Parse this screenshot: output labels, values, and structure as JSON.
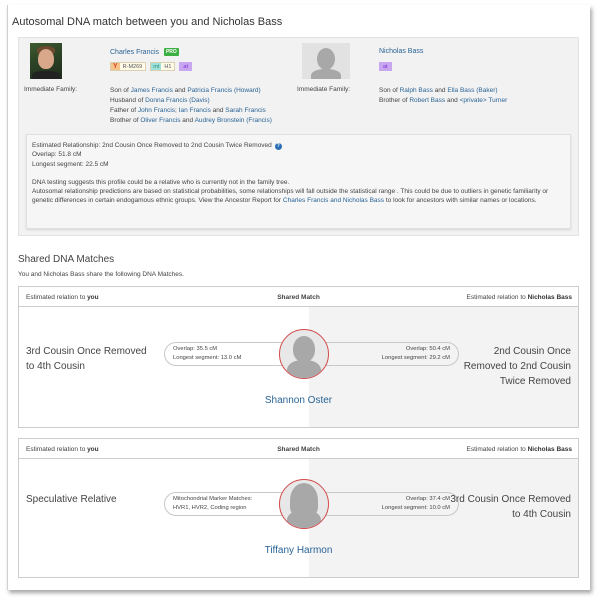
{
  "title": "Autosomal DNA match between you and Nicholas Bass",
  "you": {
    "name": "Charles Francis",
    "pro_badge": "PRO",
    "badges": [
      {
        "key": "Y",
        "value": "R-M269"
      },
      {
        "key": "mt",
        "value": "H1"
      },
      {
        "key": "at",
        "value": ""
      }
    ],
    "family_label": "Immediate Family:",
    "family": {
      "son_of_prefix": "Son of ",
      "father1": "James Francis",
      "and1": " and ",
      "mother1": "Patricia Francis (Howard)",
      "husband_prefix": "Husband of ",
      "spouse": "Donna Francis (Davis)",
      "father_of_prefix": "Father of ",
      "child1": "John Francis",
      "sep": "; ",
      "child2": "Ian Francis",
      "and2": " and ",
      "child3": "Sarah Francis",
      "brother_prefix": "Brother of ",
      "sib1": "Oliver Francis",
      "and3": " and ",
      "sib2": "Audrey Bronstein (Francis)"
    }
  },
  "them": {
    "name": "Nicholas Bass",
    "badges": [
      {
        "key": "at",
        "value": ""
      }
    ],
    "family_label": "Immediate Family:",
    "family": {
      "son_of_prefix": "Son of ",
      "father1": "Ralph Bass",
      "and1": " and ",
      "mother1": "Ella Bass (Baker)",
      "brother_prefix": "Brother of ",
      "sib1": "Robert Bass",
      "and2": " and ",
      "sib2": "<private> Turner"
    }
  },
  "estimate": {
    "relationship": "Estimated Relationship: 2nd Cousin Once Removed to 2nd Cousin Twice Removed",
    "overlap": "Overlap: 51.8 cM",
    "longest": "Longest segment: 22.5 cM",
    "note1": "DNA testing suggests this profile could be a relative who is currently not in the family tree.",
    "note2_a": "Autosomal relationship predictions are based on statistical probabilities, some relationships will fall outside the statistical range . This could be due to outliers in genetic familiarity or genetic differences in certain endogamous ethnic groups. View the Ancestor Report for ",
    "note2_link": "Charles Francis and Nicholas Bass",
    "note2_b": " to look for ancestors with similar names or locations."
  },
  "shared": {
    "title": "Shared DNA Matches",
    "subtitle": "You and Nicholas Bass share the following DNA Matches.",
    "header": {
      "col1_prefix": "Estimated relation to ",
      "col1_bold": "you",
      "col2": "Shared Match",
      "col3_prefix": "Estimated relation to ",
      "col3_bold": "Nicholas Bass"
    },
    "matches": [
      {
        "name": "Shannon Oster",
        "rel_you": "3rd Cousin Once Removed to 4th Cousin",
        "rel_you_lines": [
          "3rd Cousin Once Removed",
          "to 4th Cousin"
        ],
        "left_pill": [
          "Overlap: 35.5 cM",
          "Longest segment: 13.0 cM"
        ],
        "right_pill": [
          "Overlap: 50.4 cM",
          "Longest segment: 29.2 cM"
        ],
        "rel_them_lines": [
          "2nd Cousin Once",
          "Removed to 2nd Cousin",
          "Twice Removed"
        ]
      },
      {
        "name": "Tiffany Harmon",
        "rel_you_lines": [
          "Speculative Relative"
        ],
        "left_pill": [
          "Mitochondrial Marker Matches:",
          "HVR1, HVR2, Coding region"
        ],
        "right_pill": [
          "Overlap: 37.4 cM",
          "Longest segment: 10.0 cM"
        ],
        "rel_them_lines": [
          "3rd Cousin Once Removed",
          "to 4th Cousin"
        ]
      }
    ]
  }
}
